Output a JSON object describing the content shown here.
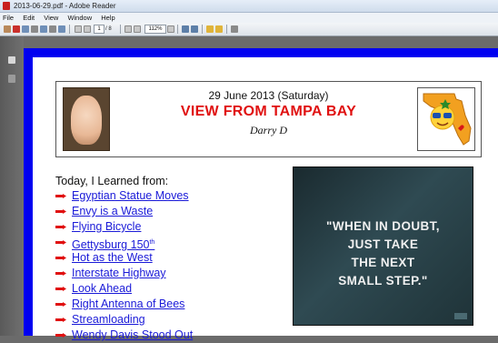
{
  "window": {
    "title": "2013-06-29.pdf - Adobe Reader"
  },
  "menu": [
    "File",
    "Edit",
    "View",
    "Window",
    "Help"
  ],
  "toolbar": {
    "page_current": "1",
    "page_total": "/ 8",
    "zoom": "112%"
  },
  "header": {
    "date": "29 June 2013 (Saturday)",
    "title": "VIEW FROM TAMPA BAY",
    "author": "Darry D"
  },
  "learned_label": "Today, I Learned from:",
  "links": [
    "Egyptian Statue Moves",
    "Envy is a Waste",
    "Flying Bicycle",
    "Gettysburg 150",
    "Hot as the West",
    "Interstate Highway",
    "Look Ahead",
    "Right Antenna of Bees",
    "Streamloading",
    "Wendy Davis Stood Out"
  ],
  "poster": {
    "lines": [
      "\"WHEN IN DOUBT,",
      "JUST TAKE",
      "THE NEXT",
      "SMALL STEP.\""
    ]
  },
  "colors": {
    "border": "#0000f0",
    "title": "#e01010",
    "link": "#1a1ad8",
    "arrow": "#e01010"
  }
}
